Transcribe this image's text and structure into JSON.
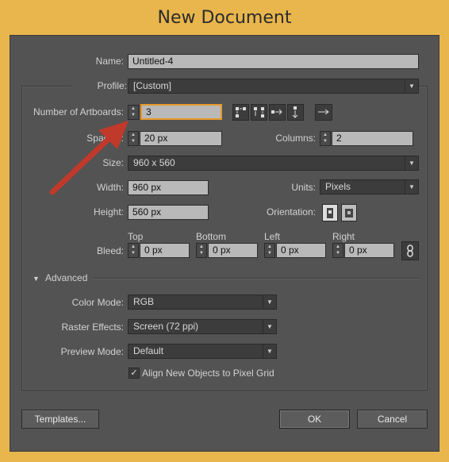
{
  "dialog": {
    "title": "New Document"
  },
  "name": {
    "label": "Name:",
    "value": "Untitled-4"
  },
  "profile": {
    "label": "Profile:",
    "value": "[Custom]"
  },
  "artboards": {
    "label": "Number of Artboards:",
    "value": "3"
  },
  "spacing": {
    "label": "Spacing:",
    "value": "20 px"
  },
  "columns": {
    "label": "Columns:",
    "value": "2"
  },
  "size": {
    "label": "Size:",
    "value": "960 x 560"
  },
  "width": {
    "label": "Width:",
    "value": "960 px"
  },
  "units": {
    "label": "Units:",
    "value": "Pixels"
  },
  "height": {
    "label": "Height:",
    "value": "560 px"
  },
  "orientation": {
    "label": "Orientation:"
  },
  "bleed": {
    "label": "Bleed:",
    "top": {
      "label": "Top",
      "value": "0 px"
    },
    "bottom": {
      "label": "Bottom",
      "value": "0 px"
    },
    "left": {
      "label": "Left",
      "value": "0 px"
    },
    "right": {
      "label": "Right",
      "value": "0 px"
    }
  },
  "advanced": {
    "label": "Advanced"
  },
  "color_mode": {
    "label": "Color Mode:",
    "value": "RGB"
  },
  "raster_effects": {
    "label": "Raster Effects:",
    "value": "Screen (72 ppi)"
  },
  "preview_mode": {
    "label": "Preview Mode:",
    "value": "Default"
  },
  "align_pixel_grid": {
    "label": "Align New Objects to Pixel Grid",
    "checked": true
  },
  "buttons": {
    "templates": "Templates...",
    "ok": "OK",
    "cancel": "Cancel"
  },
  "colors": {
    "dialog_bg": "#535353",
    "frame": "#e8b64c",
    "focus": "#e89a2c",
    "annotation_arrow": "#c0392b"
  }
}
